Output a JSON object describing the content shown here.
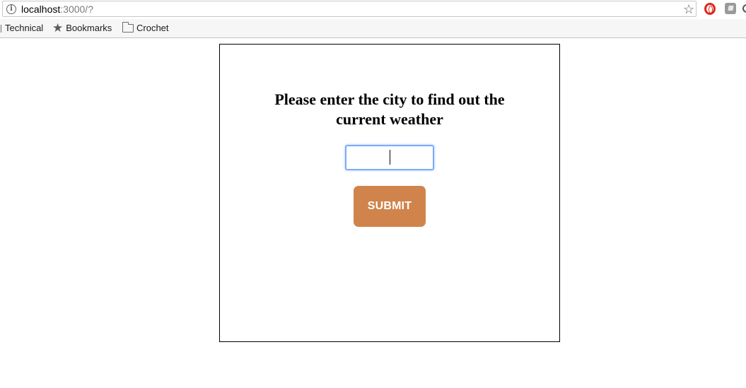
{
  "browser": {
    "address": {
      "host": "localhost",
      "path": ":3000/?"
    },
    "icons": {
      "info": "info-icon",
      "bookmark_star": "star-icon",
      "extension_1": "opera-icon",
      "extension_2": "extension-icon"
    }
  },
  "bookmarks_bar": {
    "items": [
      {
        "label": "Technical",
        "icon": "folder-icon"
      },
      {
        "label": "Bookmarks",
        "icon": "star-icon"
      },
      {
        "label": "Crochet",
        "icon": "folder-icon"
      }
    ]
  },
  "page": {
    "heading": "Please enter the city to find out the current weather",
    "city_input": {
      "value": "",
      "placeholder": ""
    },
    "submit_label": "SUBMIT",
    "colors": {
      "submit_background": "#d0844b",
      "input_focus_border": "#7cacf8"
    }
  }
}
